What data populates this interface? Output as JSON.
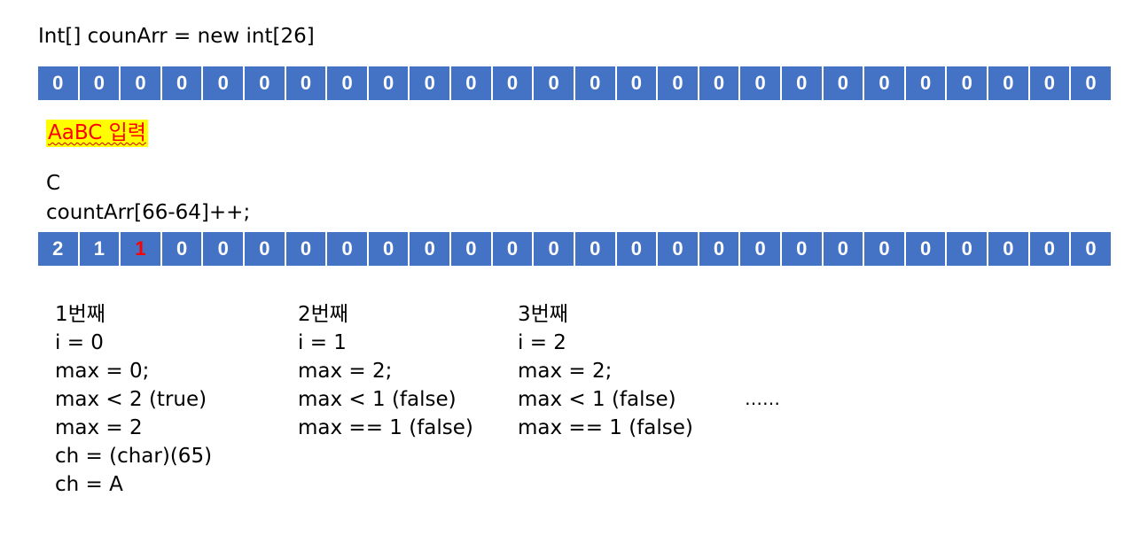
{
  "declaration": "Int[] counArr = new int[26]",
  "array_initial": [
    "0",
    "0",
    "0",
    "0",
    "0",
    "0",
    "0",
    "0",
    "0",
    "0",
    "0",
    "0",
    "0",
    "0",
    "0",
    "0",
    "0",
    "0",
    "0",
    "0",
    "0",
    "0",
    "0",
    "0",
    "0",
    "0"
  ],
  "input_label": "AaBC 입력",
  "current_char": "C",
  "increment_statement": "countArr[66-64]++;",
  "array_after": [
    "2",
    "1",
    "1",
    "0",
    "0",
    "0",
    "0",
    "0",
    "0",
    "0",
    "0",
    "0",
    "0",
    "0",
    "0",
    "0",
    "0",
    "0",
    "0",
    "0",
    "0",
    "0",
    "0",
    "0",
    "0",
    "0"
  ],
  "highlighted_index": 2,
  "colors": {
    "cell_bg": "#4472c4",
    "highlight_text": "#ff0000",
    "input_bg": "#ffff00",
    "input_text": "#ff0000"
  },
  "iterations": [
    {
      "title": "1번째",
      "lines": [
        "i = 0",
        "max = 0;",
        "max < 2 (true)",
        "max = 2",
        "ch = (char)(65)",
        "ch = A"
      ]
    },
    {
      "title": "2번째",
      "lines": [
        "i = 1",
        "max = 2;",
        "max < 1 (false)",
        "max == 1 (false)"
      ]
    },
    {
      "title": "3번째",
      "lines": [
        "i = 2",
        "max = 2;",
        "max < 1 (false)",
        "max == 1 (false)"
      ]
    }
  ],
  "ellipsis": "……"
}
